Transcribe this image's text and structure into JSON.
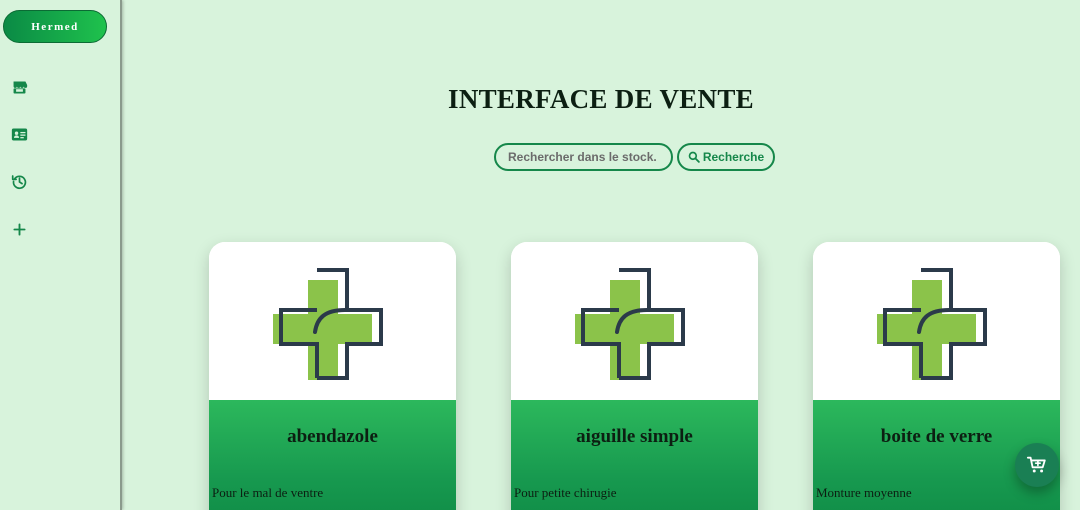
{
  "sidebar": {
    "brand": "Hermed",
    "items": [
      {
        "icon": "store-icon"
      },
      {
        "icon": "id-card-icon"
      },
      {
        "icon": "history-icon"
      },
      {
        "icon": "plus-icon"
      }
    ]
  },
  "main": {
    "title": "INTERFACE DE VENTE",
    "search": {
      "placeholder": "Rechercher dans le stock.",
      "button_label": "Recherche"
    },
    "products": [
      {
        "name": "abendazole",
        "description": "Pour le mal de ventre",
        "image": "pharmacy-cross-icon"
      },
      {
        "name": "aiguille simple",
        "description": "Pour petite chirugie",
        "image": "pharmacy-cross-icon"
      },
      {
        "name": "boite de verre",
        "description": "Monture moyenne",
        "image": "pharmacy-cross-icon"
      }
    ]
  },
  "cart": {
    "icon": "cart-plus-icon"
  },
  "colors": {
    "background": "#d8f3dc",
    "accent": "#15874a",
    "card_green": "#2cb85c",
    "cross_green": "#8bc34a",
    "cross_outline": "#2b3a4a"
  }
}
